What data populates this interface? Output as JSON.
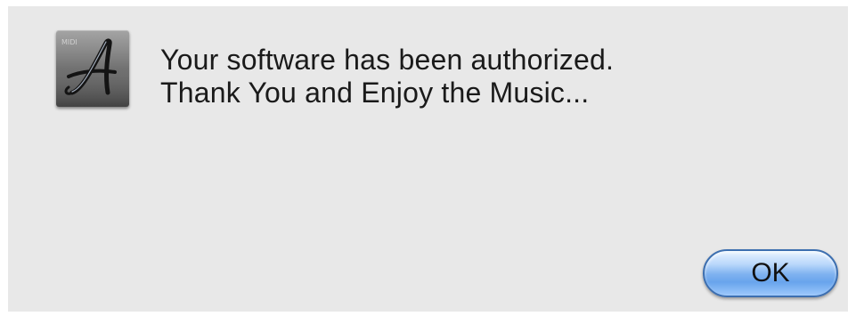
{
  "alert": {
    "icon": "app-logo-script-a-icon",
    "icon_badge_text": "MIDI",
    "message_lines": [
      "Your software has been authorized.",
      "Thank You and Enjoy the Music..."
    ],
    "ok_label": "OK"
  },
  "colors": {
    "dialog_background": "#e8e8e8",
    "button_accent": "#68a4ec",
    "text": "#1a1a1a"
  }
}
